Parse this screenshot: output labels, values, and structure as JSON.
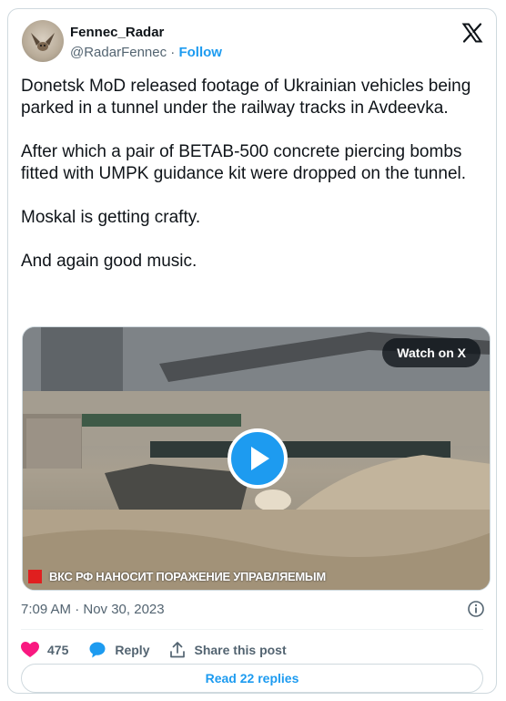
{
  "author": {
    "display_name": "Fennec_Radar",
    "handle": "@RadarFennec",
    "separator": "·",
    "follow_label": "Follow"
  },
  "tweet": {
    "text": "Donetsk MoD released footage of Ukrainian vehicles being parked in a tunnel under the railway tracks in Avdeevka.\n\nAfter which a pair of BETAB-500 concrete piercing bombs fitted with UMPK guidance kit were dropped on the tunnel.\n\nMoskal is getting crafty.\n\nAnd again good music.",
    "timestamp": "7:09 AM · Nov 30, 2023"
  },
  "media": {
    "watch_label": "Watch on X",
    "caption": "ВКС РФ НАНОСИТ ПОРАЖЕНИЕ УПРАВЛЯЕМЫМ",
    "play_icon": "play-icon"
  },
  "actions": {
    "like_count": "475",
    "reply_label": "Reply",
    "share_label": "Share this post"
  },
  "read_replies_label": "Read 22 replies",
  "colors": {
    "accent": "#1d9bf0",
    "like": "#f91880",
    "secondary_text": "#536471",
    "border": "#cfd9de"
  }
}
